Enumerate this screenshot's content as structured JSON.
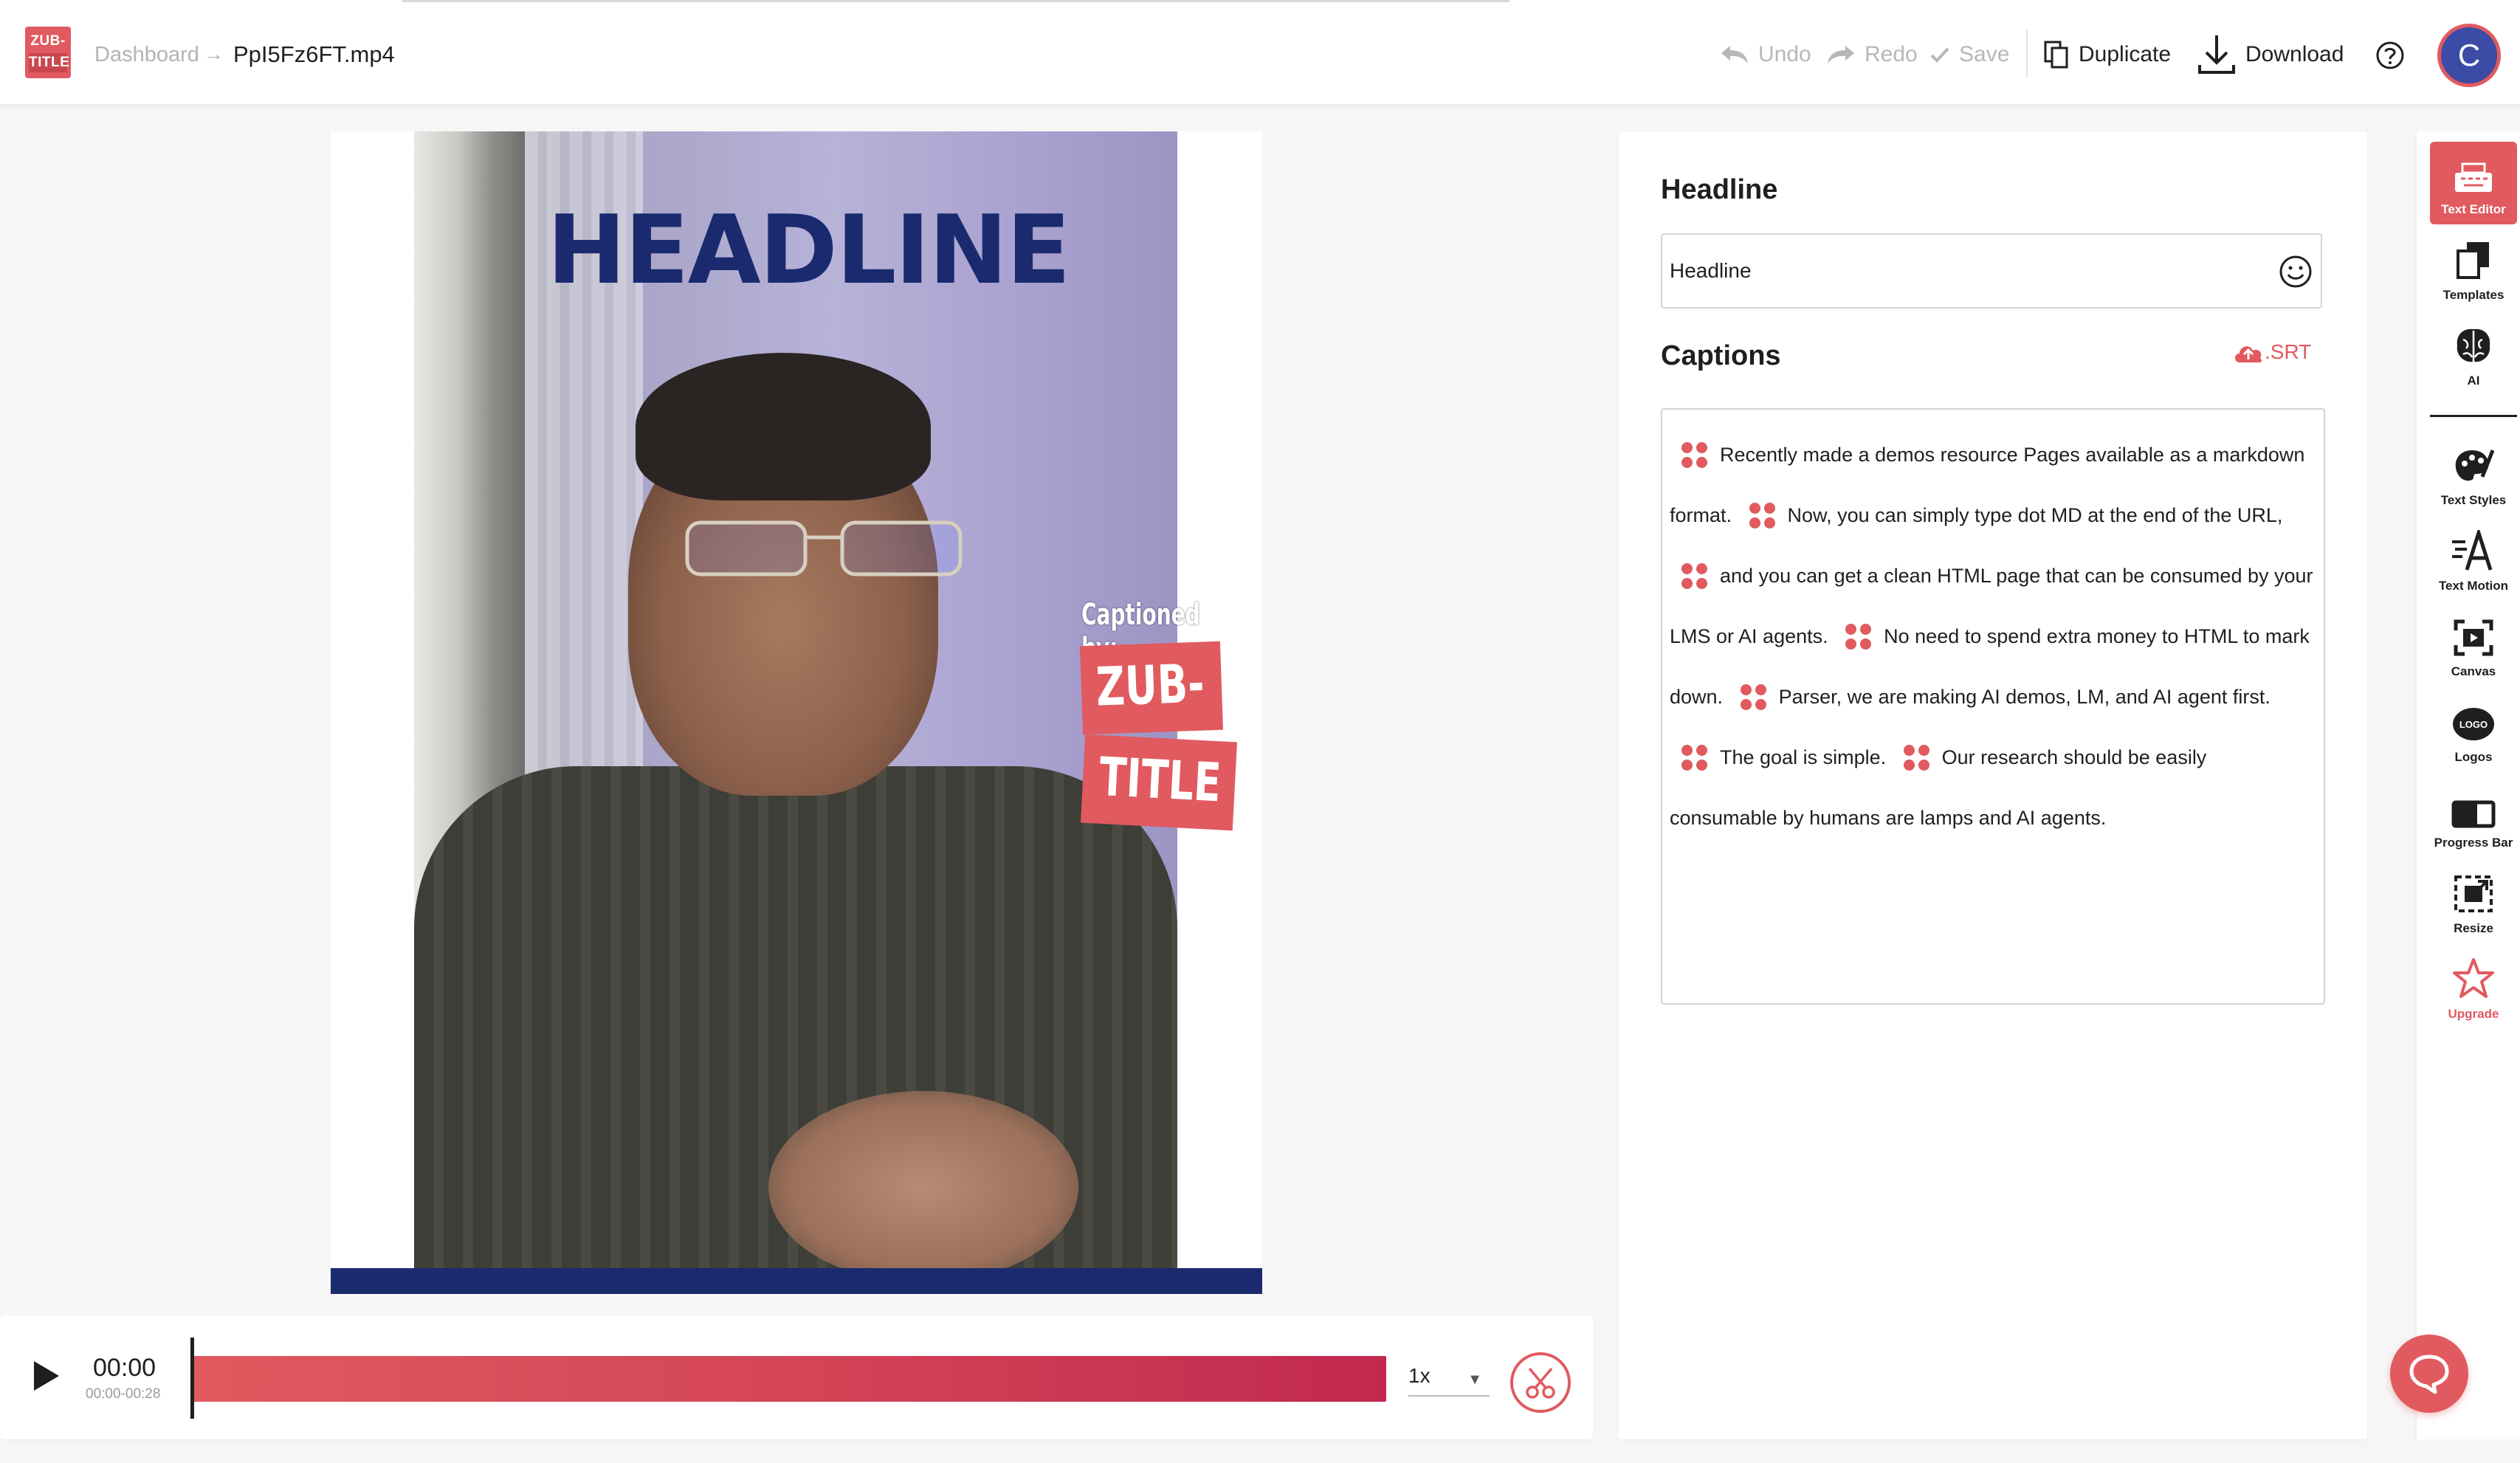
{
  "header": {
    "logo_line1": "ZUB-",
    "logo_line2": "TITLE",
    "breadcrumb_parent": "Dashboard",
    "breadcrumb_arrow": "→",
    "file_name": "PpI5Fz6FT.mp4",
    "undo_label": "Undo",
    "redo_label": "Redo",
    "save_label": "Save",
    "duplicate_label": "Duplicate",
    "download_label": "Download",
    "avatar_initial": "C"
  },
  "preview": {
    "headline_overlay": "HEADLINE",
    "captioned_by": "Captioned by:",
    "badge_line1": "ZUB-",
    "badge_line2": "TITLE"
  },
  "timeline": {
    "current_time": "00:00",
    "range": "00:00-00:28",
    "speed": "1x",
    "playhead_fraction": 0
  },
  "editor": {
    "headline_title": "Headline",
    "headline_value": "Headline",
    "captions_title": "Captions",
    "srt_label": ".SRT",
    "captions": [
      "Recently made a demos resource Pages available as a markdown format.",
      "Now, you can simply type dot MD at the end of the URL,",
      "and you can get a clean HTML page that can be consumed by your LMS or AI agents.",
      "No need to spend extra money to HTML to mark down.",
      "Parser, we are making AI demos, LM, and AI agent first.",
      "The goal is simple.",
      "Our research should be easily consumable by humans are lamps and AI agents."
    ]
  },
  "rail": {
    "text_editor": "Text Editor",
    "templates": "Templates",
    "ai": "AI",
    "text_styles": "Text Styles",
    "text_motion": "Text Motion",
    "canvas": "Canvas",
    "logos": "Logos",
    "logo_icon_text": "LOGO",
    "progress_bar": "Progress Bar",
    "resize": "Resize",
    "upgrade": "Upgrade"
  },
  "colors": {
    "accent": "#e05a5f",
    "navy": "#1b2a6e"
  }
}
